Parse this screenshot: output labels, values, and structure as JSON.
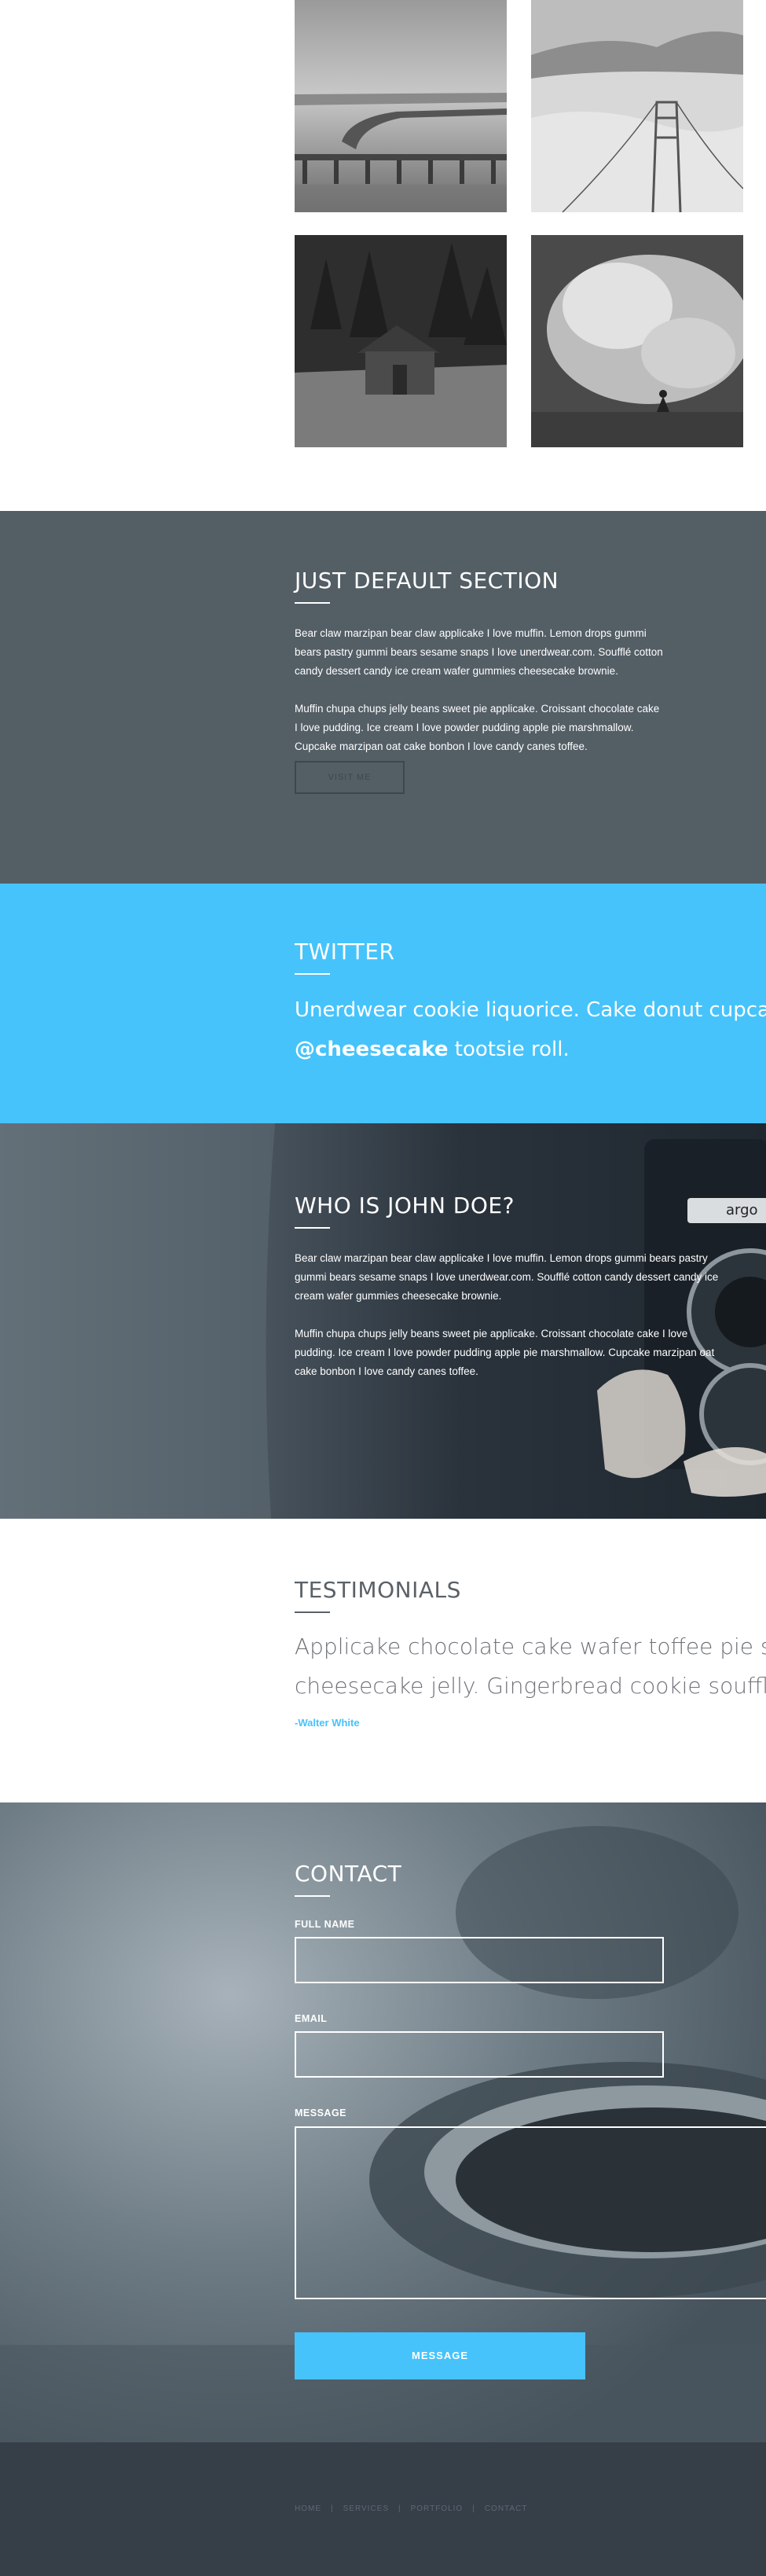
{
  "default_section": {
    "title": "JUST DEFAULT SECTION",
    "paragraphs": [
      "Bear claw marzipan bear claw applicake I love muffin. Lemon drops gummi bears pastry gummi bears sesame snaps I love unerdwear.com. Soufflé cotton candy dessert candy ice cream wafer gummies cheesecake brownie.",
      "Muffin chupa chups jelly beans sweet pie applicake. Croissant chocolate cake I love pudding. Ice cream I love powder pudding apple pie marshmallow. Cupcake marzipan oat cake bonbon I love candy canes toffee."
    ],
    "button_label": "VISIT ME"
  },
  "twitter": {
    "title": "TWITTER",
    "tweet_line1": "Unerdwear cookie liquorice. Cake donut cupcake lollipop",
    "tweet_handle": "@cheesecake",
    "tweet_line2_rest": " tootsie roll."
  },
  "who": {
    "title": "WHO IS JOHN DOE?",
    "paragraphs": [
      "Bear claw marzipan bear claw applicake I love muffin. Lemon drops gummi bears pastry gummi bears sesame snaps I love unerdwear.com. Soufflé cotton candy dessert candy ice cream wafer gummies cheesecake brownie.",
      "Muffin chupa chups jelly beans sweet pie applicake. Croissant chocolate cake I love pudding. Ice cream I love powder pudding apple pie marshmallow. Cupcake marzipan oat cake bonbon I love candy canes toffee."
    ],
    "camera_brand": "argo"
  },
  "testimonials": {
    "title": "TESTIMONIALS",
    "quote_line1": "Applicake chocolate cake wafer toffee pie soufflé wafer",
    "quote_line2": "cheesecake jelly. Gingerbread cookie soufflé sweet roll",
    "author": "-Walter White"
  },
  "contact": {
    "title": "CONTACT",
    "full_name_label": "FULL NAME",
    "email_label": "EMAIL",
    "message_label": "MESSAGE",
    "full_name_value": "",
    "email_value": "",
    "message_value": "",
    "submit_label": "MESSAGE"
  },
  "footer": {
    "links": [
      "HOME",
      "SERVICES",
      "PORTFOLIO",
      "CONTACT"
    ],
    "separator": "|"
  },
  "colors": {
    "accent": "#46c3fb",
    "slate": "#535e65",
    "dark": "#363e48"
  },
  "icons": [
    "pier-photo",
    "golden-gate-photo",
    "cabin-photo",
    "surfer-photo",
    "camera-photo",
    "coffee-cup-photo"
  ]
}
